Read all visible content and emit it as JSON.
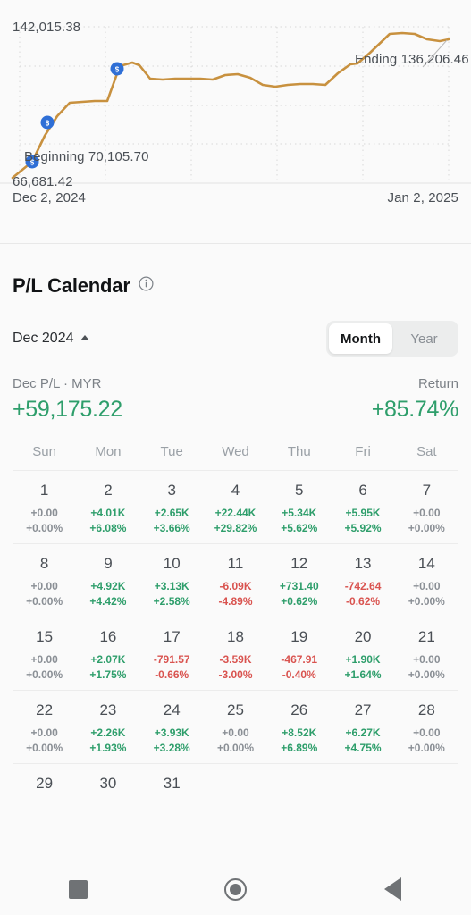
{
  "chart_data": {
    "type": "line",
    "title": "",
    "xlabel": "",
    "ylabel": "",
    "line_color": "#c8913f",
    "marker_color": "#2f6fd6",
    "grid": "dotted",
    "y_max_label": "142,015.38",
    "y_min_label": "66,681.42",
    "ylim": [
      66681.42,
      142015.38
    ],
    "x_start_label": "Dec 2, 2024",
    "x_end_label": "Jan 2, 2025",
    "beginning_label": "Beginning 70,105.70",
    "ending_label": "Ending 136,206.46",
    "beginning_value": 70105.7,
    "ending_value": 136206.46,
    "values": [
      66681.42,
      70105.7,
      78500.0,
      89000.0,
      97500.0,
      98200.0,
      98400.0,
      98500.0,
      113500.0,
      122000.0,
      126500.0,
      120500.0,
      119000.0,
      119200.0,
      119400.0,
      119300.0,
      119000.0,
      121500.0,
      122000.0,
      120200.0,
      116800.0,
      116000.0,
      116600.0,
      117000.0,
      117100.0,
      117000.0,
      121500.0,
      126500.0,
      127000.0,
      131000.0,
      138500.0,
      139300.0,
      139200.0,
      137200.0,
      136000.0,
      136206.46
    ],
    "markers": [
      {
        "x_index": 1,
        "label": "$"
      },
      {
        "x_index": 8,
        "label": "$"
      },
      {
        "x_index": 10,
        "label": "$"
      }
    ]
  },
  "pl_calendar": {
    "title": "P/L Calendar",
    "info_icon": "info-icon",
    "month_label": "Dec 2024",
    "caret": "caret-up-icon",
    "toggle": {
      "options": [
        "Month",
        "Year"
      ],
      "selected": "Month"
    },
    "summary": {
      "left_caption": "Dec P/L · MYR",
      "left_value": "+59,175.22",
      "left_sign": "pos",
      "right_caption": "Return",
      "right_value": "+85.74%",
      "right_sign": "pos"
    },
    "dow": [
      "Sun",
      "Mon",
      "Tue",
      "Wed",
      "Thu",
      "Fri",
      "Sat"
    ],
    "weeks": [
      [
        {
          "day": "1",
          "amt": "+0.00",
          "pct": "+0.00%",
          "sign": "zero"
        },
        {
          "day": "2",
          "amt": "+4.01K",
          "pct": "+6.08%",
          "sign": "pos"
        },
        {
          "day": "3",
          "amt": "+2.65K",
          "pct": "+3.66%",
          "sign": "pos"
        },
        {
          "day": "4",
          "amt": "+22.44K",
          "pct": "+29.82%",
          "sign": "pos"
        },
        {
          "day": "5",
          "amt": "+5.34K",
          "pct": "+5.62%",
          "sign": "pos"
        },
        {
          "day": "6",
          "amt": "+5.95K",
          "pct": "+5.92%",
          "sign": "pos"
        },
        {
          "day": "7",
          "amt": "+0.00",
          "pct": "+0.00%",
          "sign": "zero"
        }
      ],
      [
        {
          "day": "8",
          "amt": "+0.00",
          "pct": "+0.00%",
          "sign": "zero"
        },
        {
          "day": "9",
          "amt": "+4.92K",
          "pct": "+4.42%",
          "sign": "pos"
        },
        {
          "day": "10",
          "amt": "+3.13K",
          "pct": "+2.58%",
          "sign": "pos"
        },
        {
          "day": "11",
          "amt": "-6.09K",
          "pct": "-4.89%",
          "sign": "neg"
        },
        {
          "day": "12",
          "amt": "+731.40",
          "pct": "+0.62%",
          "sign": "pos"
        },
        {
          "day": "13",
          "amt": "-742.64",
          "pct": "-0.62%",
          "sign": "neg"
        },
        {
          "day": "14",
          "amt": "+0.00",
          "pct": "+0.00%",
          "sign": "zero"
        }
      ],
      [
        {
          "day": "15",
          "amt": "+0.00",
          "pct": "+0.00%",
          "sign": "zero"
        },
        {
          "day": "16",
          "amt": "+2.07K",
          "pct": "+1.75%",
          "sign": "pos"
        },
        {
          "day": "17",
          "amt": "-791.57",
          "pct": "-0.66%",
          "sign": "neg"
        },
        {
          "day": "18",
          "amt": "-3.59K",
          "pct": "-3.00%",
          "sign": "neg"
        },
        {
          "day": "19",
          "amt": "-467.91",
          "pct": "-0.40%",
          "sign": "neg"
        },
        {
          "day": "20",
          "amt": "+1.90K",
          "pct": "+1.64%",
          "sign": "pos"
        },
        {
          "day": "21",
          "amt": "+0.00",
          "pct": "+0.00%",
          "sign": "zero"
        }
      ],
      [
        {
          "day": "22",
          "amt": "+0.00",
          "pct": "+0.00%",
          "sign": "zero"
        },
        {
          "day": "23",
          "amt": "+2.26K",
          "pct": "+1.93%",
          "sign": "pos"
        },
        {
          "day": "24",
          "amt": "+3.93K",
          "pct": "+3.28%",
          "sign": "pos"
        },
        {
          "day": "25",
          "amt": "+0.00",
          "pct": "+0.00%",
          "sign": "zero"
        },
        {
          "day": "26",
          "amt": "+8.52K",
          "pct": "+6.89%",
          "sign": "pos"
        },
        {
          "day": "27",
          "amt": "+6.27K",
          "pct": "+4.75%",
          "sign": "pos"
        },
        {
          "day": "28",
          "amt": "+0.00",
          "pct": "+0.00%",
          "sign": "zero"
        }
      ],
      [
        {
          "day": "29",
          "amt": "",
          "pct": "",
          "sign": "zero"
        },
        {
          "day": "30",
          "amt": "",
          "pct": "",
          "sign": "zero"
        },
        {
          "day": "31",
          "amt": "",
          "pct": "",
          "sign": "zero"
        },
        {
          "day": "",
          "amt": "",
          "pct": "",
          "sign": "zero"
        },
        {
          "day": "",
          "amt": "",
          "pct": "",
          "sign": "zero"
        },
        {
          "day": "",
          "amt": "",
          "pct": "",
          "sign": "zero"
        },
        {
          "day": "",
          "amt": "",
          "pct": "",
          "sign": "zero"
        }
      ]
    ]
  },
  "navbar": {
    "recents": "square-icon",
    "home": "circle-icon",
    "back": "triangle-left-icon"
  },
  "colors": {
    "positive": "#2e9e6b",
    "negative": "#d9534f",
    "neutral": "#8a8f95",
    "chart_line": "#c8913f",
    "marker": "#2f6fd6"
  }
}
